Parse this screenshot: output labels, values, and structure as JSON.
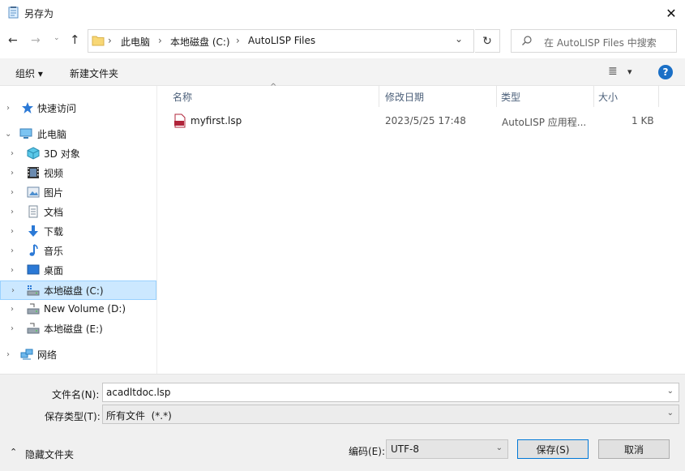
{
  "window": {
    "title": "另存为",
    "close_symbol": "✕"
  },
  "nav_buttons": {
    "back": "←",
    "forward": "→",
    "recent": "⌄",
    "up": "↑",
    "refresh": "↻"
  },
  "address": {
    "crumbs": [
      "此电脑",
      "本地磁盘 (C:)",
      "AutoLISP Files"
    ],
    "separator": "›",
    "dropdown": "⌄"
  },
  "search": {
    "placeholder": "在 AutoLISP Files 中搜索",
    "icon": "search-icon"
  },
  "toolbar": {
    "organize": "组织 ▾",
    "new_folder": "新建文件夹",
    "view_icon": "≣",
    "view_arrow": "▾",
    "help": "?"
  },
  "nav": {
    "quick_access": "快速访问",
    "this_pc": "此电脑",
    "items": [
      {
        "label": "3D 对象",
        "icon": "3d-objects-icon"
      },
      {
        "label": "视频",
        "icon": "video-icon"
      },
      {
        "label": "图片",
        "icon": "pictures-icon"
      },
      {
        "label": "文档",
        "icon": "documents-icon"
      },
      {
        "label": "下载",
        "icon": "downloads-icon"
      },
      {
        "label": "音乐",
        "icon": "music-icon"
      },
      {
        "label": "桌面",
        "icon": "desktop-icon"
      },
      {
        "label": "本地磁盘 (C:)",
        "icon": "drive-c-icon"
      },
      {
        "label": "New Volume (D:)",
        "icon": "drive-d-icon"
      },
      {
        "label": "本地磁盘 (E:)",
        "icon": "drive-e-icon"
      }
    ],
    "network": "网络",
    "chevron_right": "›",
    "chevron_down": "⌄"
  },
  "columns": {
    "name": "名称",
    "modified": "修改日期",
    "type": "类型",
    "size": "大小",
    "sort_arrow": "^"
  },
  "files": [
    {
      "name": "myfirst.lsp",
      "modified": "2023/5/25 17:48",
      "type": "AutoLISP 应用程...",
      "size": "1 KB",
      "icon_text": "LSP"
    }
  ],
  "save": {
    "filename_label": "文件名(N):",
    "filename_value": "acadltdoc.lsp",
    "filetype_label": "保存类型(T):",
    "filetype_value": "所有文件  (*.*)",
    "encoding_label": "编码(E):",
    "encoding_value": "UTF-8",
    "save_button": "保存(S)",
    "cancel_button": "取消",
    "hide_folders": "隐藏文件夹",
    "dropdown": "⌄"
  },
  "colors": {
    "accent": "#0078d7",
    "selection": "#cce8ff",
    "help_blue": "#1a6fc6",
    "lsp_red": "#b0243a"
  }
}
